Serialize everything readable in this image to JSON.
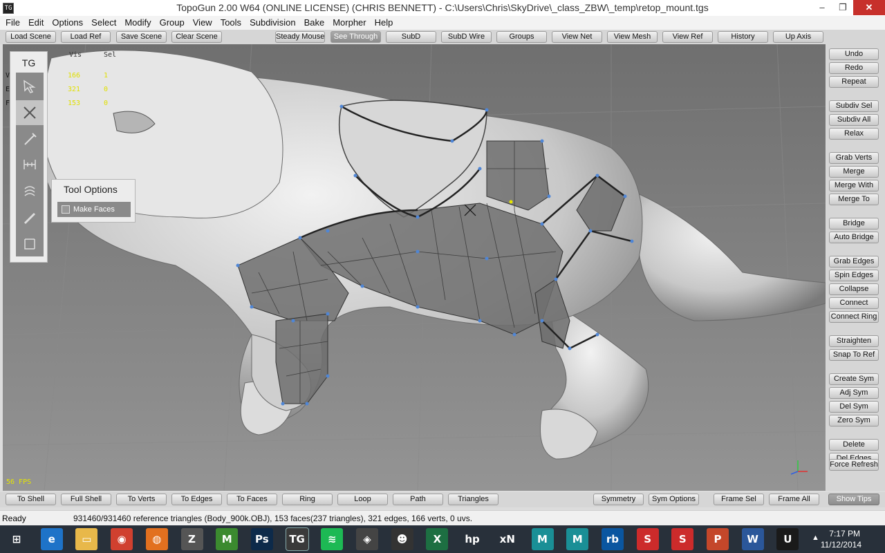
{
  "window": {
    "title": "TopoGun 2.00 W64  (ONLINE LICENSE) (CHRIS BENNETT) - C:\\Users\\Chris\\SkyDrive\\_class_ZBW\\_temp\\retop_mount.tgs",
    "app_icon": "TG",
    "minimize": "‒",
    "restore": "❐",
    "close": "✕"
  },
  "menu": [
    "File",
    "Edit",
    "Options",
    "Select",
    "Modify",
    "Group",
    "View",
    "Tools",
    "Subdivision",
    "Bake",
    "Morpher",
    "Help"
  ],
  "top_toolbar": [
    "Load Scene",
    "Load Ref",
    "Save Scene",
    "Clear Scene",
    "Steady Mouse",
    "See Through",
    "SubD",
    "SubD Wire",
    "Groups",
    "View Net",
    "View Mesh",
    "View Ref",
    "History",
    "Up Axis"
  ],
  "top_toolbar_active": "See Through",
  "tool_palette": {
    "label": "TG",
    "tools": [
      "select-tool-icon",
      "edit-tool-icon",
      "draw-tool-icon",
      "bridge-tool-icon",
      "brush-tool-icon",
      "tubes-tool-icon",
      "measure-tool-icon"
    ]
  },
  "stats": {
    "col_vis": "Vis",
    "col_sel": "Sel",
    "rows": [
      {
        "label": "V",
        "vis": "166",
        "sel": "1"
      },
      {
        "label": "E",
        "vis": "321",
        "sel": "0"
      },
      {
        "label": "F",
        "vis": "153",
        "sel": "0"
      }
    ]
  },
  "tool_options": {
    "title": "Tool Options",
    "make_faces_label": "Make Faces",
    "make_faces_checked": false
  },
  "fps": "56 FPS",
  "right_panel": {
    "groups": [
      [
        "Undo",
        "Redo",
        "Repeat"
      ],
      [
        "Subdiv Sel",
        "Subdiv All",
        "Relax"
      ],
      [
        "Grab Verts",
        "Merge",
        "Merge With",
        "Merge To"
      ],
      [
        "Bridge",
        "Auto Bridge"
      ],
      [
        "Grab Edges",
        "Spin Edges",
        "Collapse",
        "Connect",
        "Connect Ring"
      ],
      [
        "Straighten",
        "Snap To Ref"
      ],
      [
        "Create Sym",
        "Adj Sym",
        "Del Sym",
        "Zero Sym"
      ],
      [
        "Delete",
        "Del Edges"
      ]
    ],
    "force_refresh": "Force Refresh"
  },
  "bottom_toolbar": {
    "left": [
      "To Shell",
      "Full Shell",
      "To Verts",
      "To Edges",
      "To Faces",
      "Ring",
      "Loop",
      "Path",
      "Triangles"
    ],
    "right": [
      "Symmetry",
      "Sym Options",
      "Frame Sel",
      "Frame All"
    ],
    "show_tips": "Show Tips"
  },
  "status": {
    "ready": "Ready",
    "message": "931460/931460 reference triangles (Body_900k.OBJ), 153 faces(237 triangles), 321 edges, 166 verts, 0 uvs."
  },
  "taskbar": {
    "apps": [
      {
        "name": "start-icon",
        "glyph": "⊞",
        "color": "#28303a"
      },
      {
        "name": "internet-explorer-icon",
        "glyph": "e",
        "color": "#1e73c8"
      },
      {
        "name": "file-explorer-icon",
        "glyph": "▭",
        "color": "#e8b84a"
      },
      {
        "name": "chrome-icon",
        "glyph": "◉",
        "color": "#d0402f"
      },
      {
        "name": "firefox-icon",
        "glyph": "◍",
        "color": "#e2701f"
      },
      {
        "name": "zbrush-icon",
        "glyph": "Z",
        "color": "#555555"
      },
      {
        "name": "mudbox-icon",
        "glyph": "M",
        "color": "#3b8a2f"
      },
      {
        "name": "photoshop-icon",
        "glyph": "Ps",
        "color": "#0d2a4a"
      },
      {
        "name": "topogun-icon",
        "glyph": "TG",
        "color": "#3a3a3a"
      },
      {
        "name": "spotify-icon",
        "glyph": "≋",
        "color": "#1db954"
      },
      {
        "name": "unity-icon",
        "glyph": "◈",
        "color": "#444444"
      },
      {
        "name": "xnormal-icon",
        "glyph": "☻",
        "color": "#333333"
      },
      {
        "name": "excel-icon",
        "glyph": "X",
        "color": "#1d6f42"
      },
      {
        "name": "hp-icon",
        "glyph": "hp",
        "color": "#28303a"
      },
      {
        "name": "xnview-icon",
        "glyph": "xN",
        "color": "#28303a"
      },
      {
        "name": "maya-lt-icon",
        "glyph": "M",
        "color": "#1a8f96"
      },
      {
        "name": "maya-icon",
        "glyph": "M",
        "color": "#1a8f96"
      },
      {
        "name": "rb-icon",
        "glyph": "rb",
        "color": "#0a56a0"
      },
      {
        "name": "substance-designer-icon",
        "glyph": "S",
        "color": "#cc2b2b"
      },
      {
        "name": "substance-painter-icon",
        "glyph": "S",
        "color": "#cc2b2b"
      },
      {
        "name": "powerpoint-icon",
        "glyph": "P",
        "color": "#c4472a"
      },
      {
        "name": "word-icon",
        "glyph": "W",
        "color": "#2b579a"
      },
      {
        "name": "unreal-icon",
        "glyph": "U",
        "color": "#1a1a1a"
      }
    ],
    "tray_chevron": "▲",
    "time": "7:17 PM",
    "date": "11/12/2014"
  }
}
